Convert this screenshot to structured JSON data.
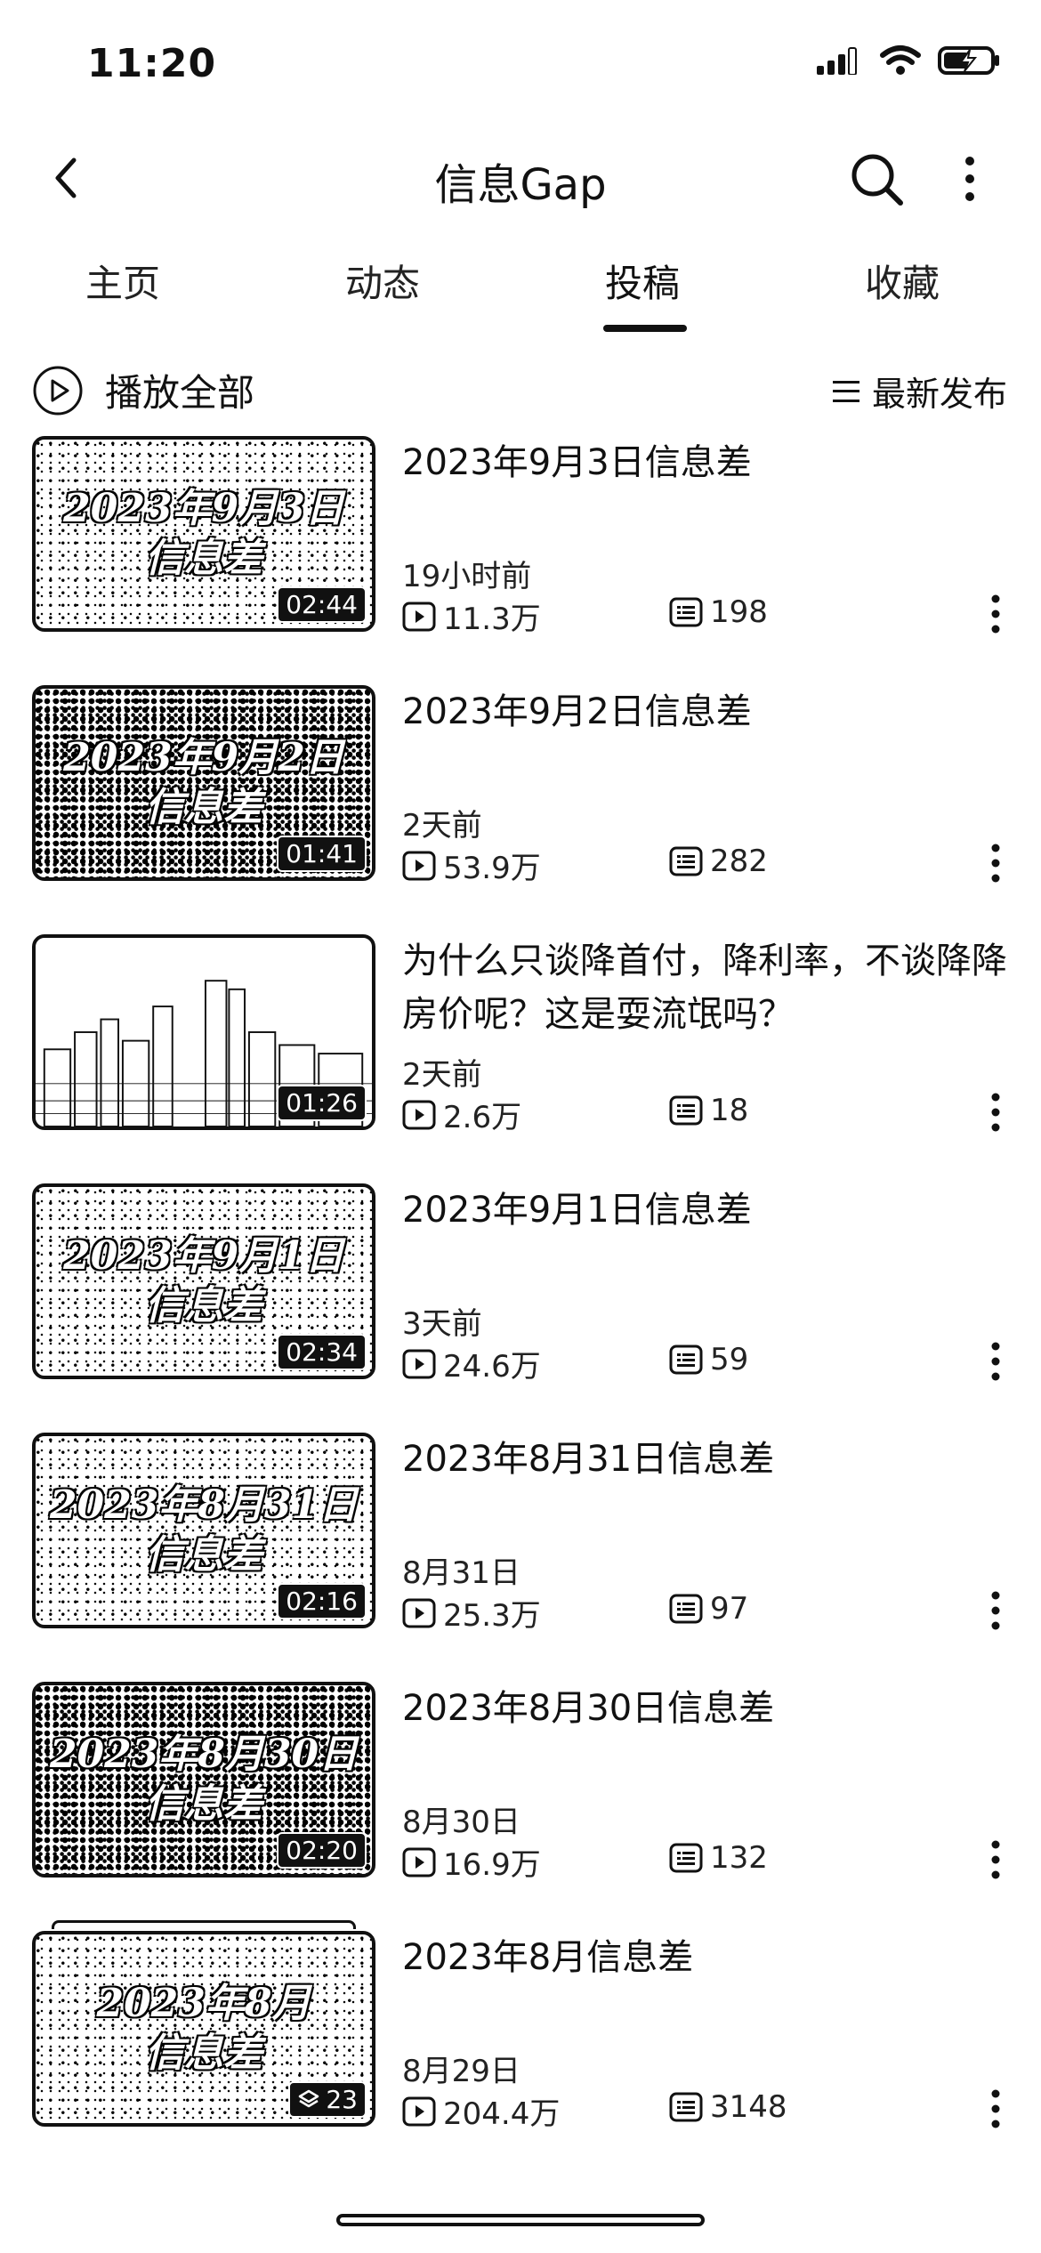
{
  "status": {
    "time": "11:20"
  },
  "header": {
    "title": "信息Gap"
  },
  "tabs": [
    {
      "label": "主页"
    },
    {
      "label": "动态"
    },
    {
      "label": "投稿"
    },
    {
      "label": "收藏"
    }
  ],
  "toolbar": {
    "play_all_label": "播放全部",
    "sort_label": "最新发布"
  },
  "videos": [
    {
      "title": "2023年9月3日信息差",
      "thumb_text": "2023年9月3日\n信息差",
      "duration": "02:44",
      "time": "19小时前",
      "views": "11.3万",
      "comments": "198"
    },
    {
      "title": "2023年9月2日信息差",
      "thumb_text": "2023年9月2日\n信息差",
      "duration": "01:41",
      "time": "2天前",
      "views": "53.9万",
      "comments": "282"
    },
    {
      "title": "为什么只谈降首付，降利率，不谈降降房价呢？这是耍流氓吗？",
      "thumb_text": "",
      "duration": "01:26",
      "time": "2天前",
      "views": "2.6万",
      "comments": "18"
    },
    {
      "title": "2023年9月1日信息差",
      "thumb_text": "2023年9月1日\n信息差",
      "duration": "02:34",
      "time": "3天前",
      "views": "24.6万",
      "comments": "59"
    },
    {
      "title": "2023年8月31日信息差",
      "thumb_text": "2023年8月31日\n信息差",
      "duration": "02:16",
      "time": "8月31日",
      "views": "25.3万",
      "comments": "97"
    },
    {
      "title": "2023年8月30日信息差",
      "thumb_text": "2023年8月30日\n信息差",
      "duration": "02:20",
      "time": "8月30日",
      "views": "16.9万",
      "comments": "132"
    },
    {
      "title": "2023年8月信息差",
      "thumb_text": "2023年8月\n信息差",
      "duration": "23",
      "time": "8月29日",
      "views": "204.4万",
      "comments": "3148"
    }
  ]
}
